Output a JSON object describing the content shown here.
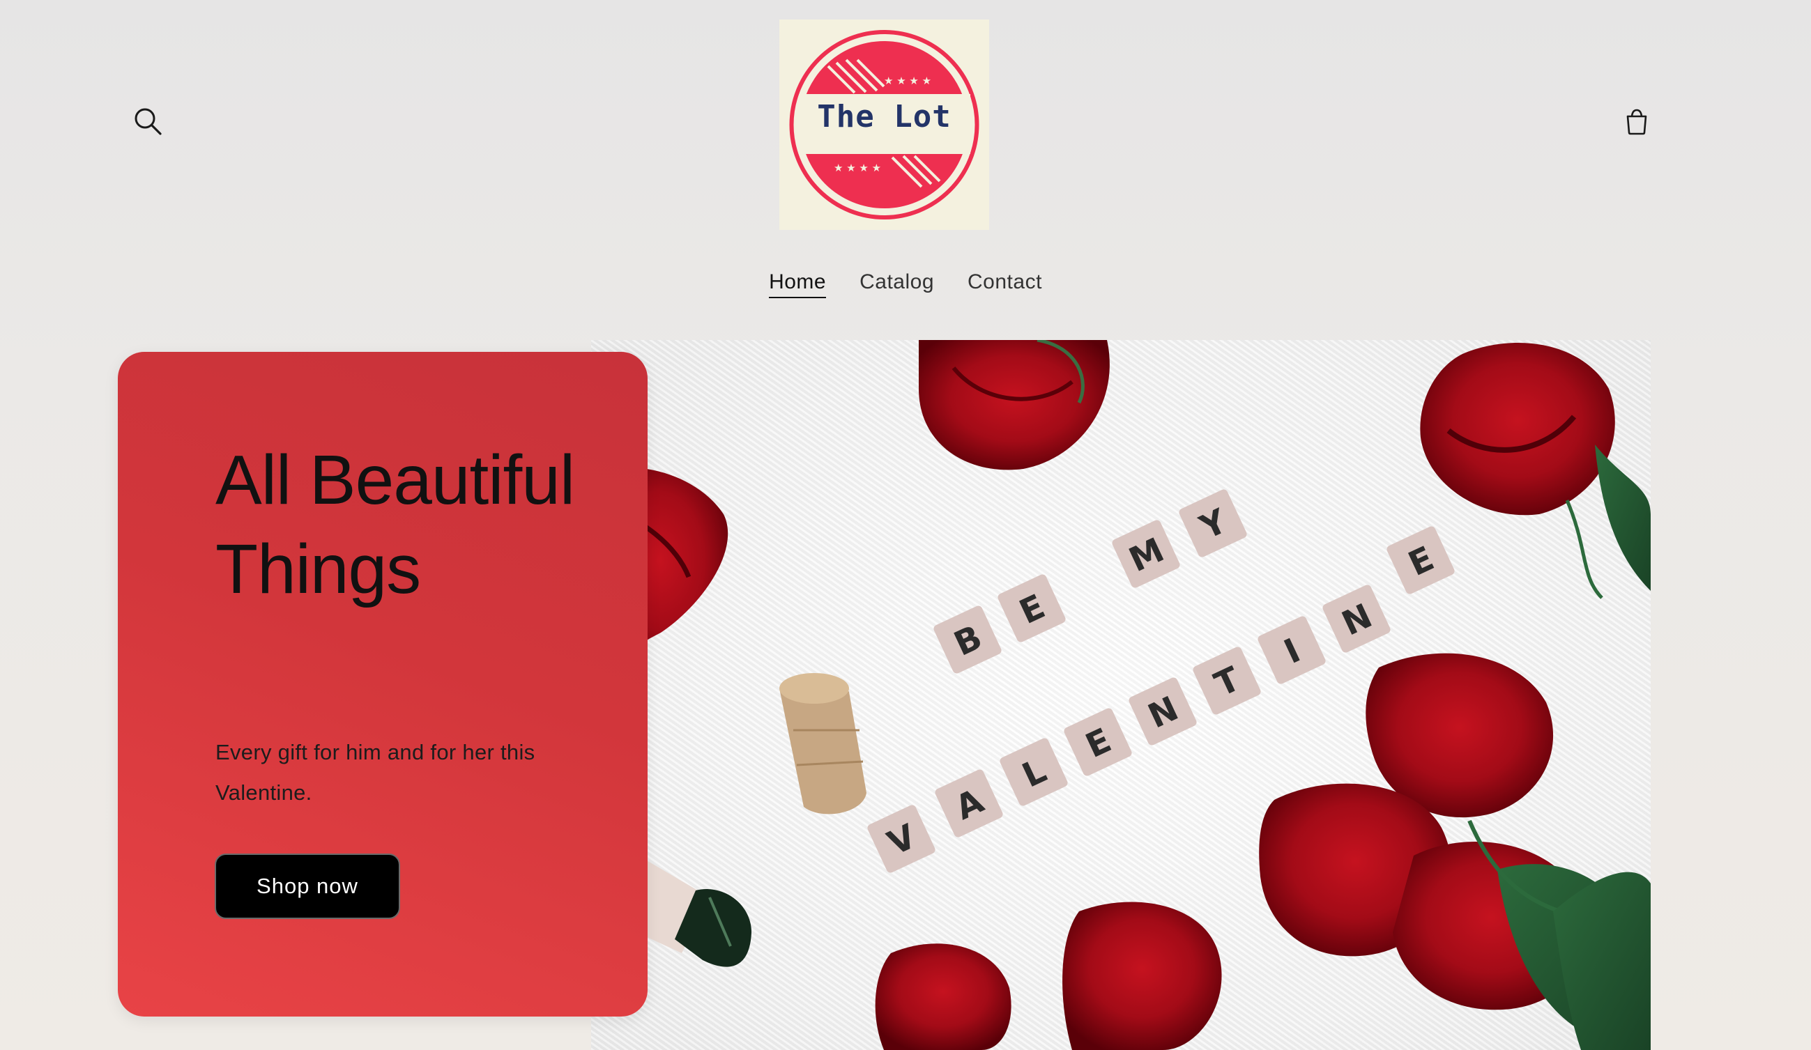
{
  "header": {
    "search_icon": "search-icon",
    "cart_icon": "cart-icon",
    "logo": {
      "text": "The Lot",
      "ring_color": "#ee2f50",
      "background": "#f4f1df",
      "text_color": "#233468"
    }
  },
  "nav": {
    "items": [
      {
        "label": "Home",
        "active": true
      },
      {
        "label": "Catalog",
        "active": false
      },
      {
        "label": "Contact",
        "active": false
      }
    ]
  },
  "hero": {
    "title": "All Beautiful Things",
    "subtitle": "Every gift for him and for her this Valentine.",
    "button_label": "Shop now",
    "card_color": "#d2363b",
    "image": {
      "tiles_line1": [
        "B",
        "E",
        "M",
        "Y"
      ],
      "tiles_line2": [
        "V",
        "A",
        "L",
        "E",
        "N",
        "T",
        "I",
        "N",
        "E"
      ]
    }
  }
}
